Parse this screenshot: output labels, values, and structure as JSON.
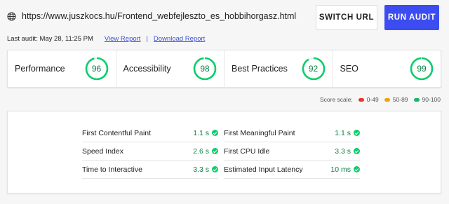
{
  "header": {
    "url": "https://www.juszkocs.hu/Frontend_webfejleszto_es_hobbihorgasz.html",
    "switch_label": "SWITCH URL",
    "run_label": "RUN AUDIT",
    "last_audit": "Last audit: May 28, 11:25 PM",
    "view_report": "View Report",
    "separator": "|",
    "download_report": "Download Report"
  },
  "scores": [
    {
      "label": "Performance",
      "value": "96",
      "fraction": 0.96
    },
    {
      "label": "Accessibility",
      "value": "98",
      "fraction": 0.98
    },
    {
      "label": "Best Practices",
      "value": "92",
      "fraction": 0.92
    },
    {
      "label": "SEO",
      "value": "99",
      "fraction": 0.99
    }
  ],
  "legend": {
    "title": "Score scale:",
    "items": [
      {
        "label": "0-49",
        "color": "#e8352e"
      },
      {
        "label": "50-89",
        "color": "#f0a30a"
      },
      {
        "label": "90-100",
        "color": "#18b663"
      }
    ]
  },
  "metrics": {
    "left": [
      {
        "name": "First Contentful Paint",
        "value": "1.1 s"
      },
      {
        "name": "Speed Index",
        "value": "2.6 s"
      },
      {
        "name": "Time to Interactive",
        "value": "3.3 s"
      }
    ],
    "right": [
      {
        "name": "First Meaningful Paint",
        "value": "1.1 s"
      },
      {
        "name": "First CPU Idle",
        "value": "3.3 s"
      },
      {
        "name": "Estimated Input Latency",
        "value": "10 ms"
      }
    ]
  },
  "colors": {
    "pass": "#0cce6b",
    "accent": "#3c4cf0",
    "link": "#3c54d6"
  }
}
